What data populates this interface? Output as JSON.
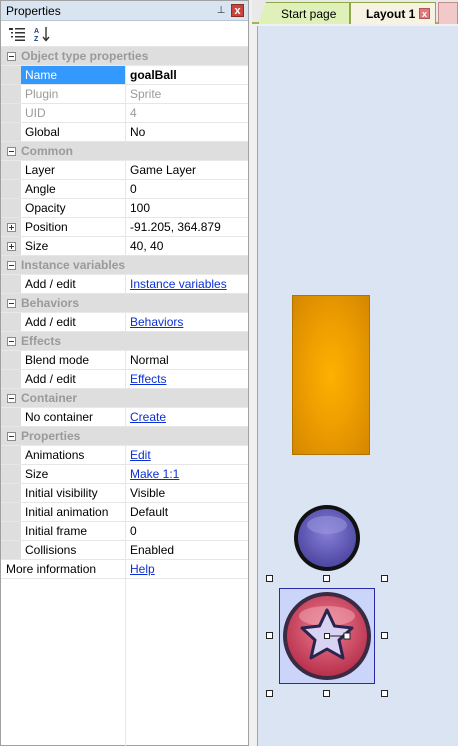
{
  "properties_panel": {
    "title": "Properties",
    "pin_glyph": "⊥",
    "close_glyph": "x",
    "toolbar": {
      "categorized_icon": "categorized-icon",
      "sort_icon": "sort-az-icon"
    },
    "categories": [
      {
        "label": "Object type properties",
        "rows": [
          {
            "name": "Name",
            "value": "goalBall",
            "selected": true
          },
          {
            "name": "Plugin",
            "value": "Sprite",
            "dim": true
          },
          {
            "name": "UID",
            "value": "4",
            "dim": true
          },
          {
            "name": "Global",
            "value": "No"
          }
        ]
      },
      {
        "label": "Common",
        "rows": [
          {
            "name": "Layer",
            "value": "Game Layer"
          },
          {
            "name": "Angle",
            "value": "0"
          },
          {
            "name": "Opacity",
            "value": "100"
          },
          {
            "name": "Position",
            "value": "-91.205, 364.879",
            "expandable": true
          },
          {
            "name": "Size",
            "value": "40, 40",
            "expandable": true
          }
        ]
      },
      {
        "label": "Instance variables",
        "rows": [
          {
            "name": "Add / edit",
            "value": "Instance variables",
            "link": true
          }
        ]
      },
      {
        "label": "Behaviors",
        "rows": [
          {
            "name": "Add / edit",
            "value": "Behaviors",
            "link": true
          }
        ]
      },
      {
        "label": "Effects",
        "rows": [
          {
            "name": "Blend mode",
            "value": "Normal"
          },
          {
            "name": "Add / edit",
            "value": "Effects",
            "link": true
          }
        ]
      },
      {
        "label": "Container",
        "rows": [
          {
            "name": "No container",
            "value": "Create",
            "link": true
          }
        ]
      },
      {
        "label": "Properties",
        "rows": [
          {
            "name": "Animations",
            "value": "Edit",
            "link": true
          },
          {
            "name": "Size",
            "value": "Make 1:1",
            "link": true
          },
          {
            "name": "Initial visibility",
            "value": "Visible"
          },
          {
            "name": "Initial animation",
            "value": "Default"
          },
          {
            "name": "Initial frame",
            "value": "0"
          },
          {
            "name": "Collisions",
            "value": "Enabled"
          }
        ]
      }
    ],
    "footer": {
      "name": "More information",
      "value": "Help"
    }
  },
  "layout_view": {
    "tabs": [
      {
        "label": "Start page",
        "active": false
      },
      {
        "label": "Layout 1",
        "active": true
      }
    ],
    "tab_close_glyph": "x",
    "colors": {
      "canvas": "#dae4f2",
      "orange_sprite": "#ffb000",
      "blue_ball": "#5a54b0",
      "goal_ball": "#d84d6a",
      "selection": "#c0c8ff"
    }
  }
}
